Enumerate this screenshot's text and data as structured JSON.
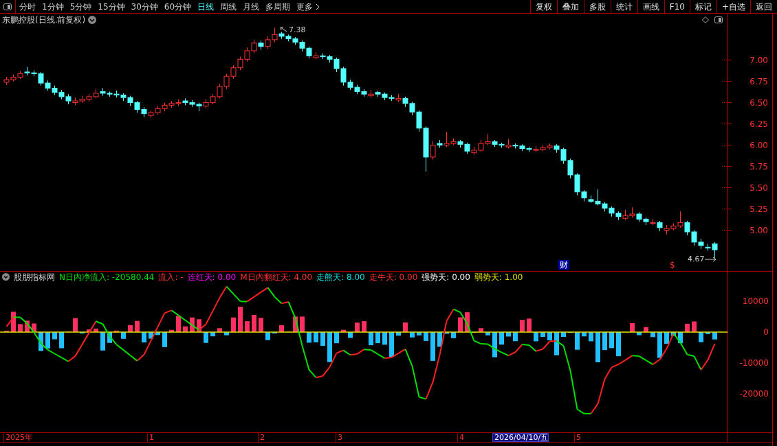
{
  "toolbar": {
    "periods": [
      {
        "label": "分时",
        "selected": false
      },
      {
        "label": "1分钟",
        "selected": false
      },
      {
        "label": "5分钟",
        "selected": false
      },
      {
        "label": "15分钟",
        "selected": false
      },
      {
        "label": "30分钟",
        "selected": false
      },
      {
        "label": "60分钟",
        "selected": false
      },
      {
        "label": "日线",
        "selected": true
      },
      {
        "label": "周线",
        "selected": false
      },
      {
        "label": "月线",
        "selected": false
      },
      {
        "label": "多周期",
        "selected": false
      }
    ],
    "more": "更多",
    "actions": [
      "复权",
      "叠加",
      "多股",
      "统计",
      "画线",
      "F10",
      "标记",
      "+自选",
      "返回"
    ]
  },
  "price_panel": {
    "title": "东鹏控股(日线.前复权)",
    "high_label": "7.38",
    "low_label": "4.67",
    "markers": [
      {
        "text": "财",
        "kind": "finance"
      },
      {
        "text": "$",
        "kind": "dividend"
      }
    ],
    "chart_data": {
      "type": "candlestick",
      "ylim": [
        4.52,
        7.4
      ],
      "yticks": [
        {
          "value": 7,
          "label": "7.00"
        },
        {
          "value": 6.75,
          "label": "6.75"
        },
        {
          "value": 6.5,
          "label": "6.50"
        },
        {
          "value": 6.25,
          "label": "6.25"
        },
        {
          "value": 6,
          "label": "6.00"
        },
        {
          "value": 5.75,
          "label": "5.75"
        },
        {
          "value": 5.5,
          "label": "5.50"
        },
        {
          "value": 5.25,
          "label": "5.25"
        },
        {
          "value": 5,
          "label": "5.00"
        }
      ],
      "ohlc": [
        [
          6.74,
          6.8,
          6.71,
          6.77
        ],
        [
          6.77,
          6.83,
          6.75,
          6.8
        ],
        [
          6.8,
          6.87,
          6.78,
          6.84
        ],
        [
          6.86,
          6.92,
          6.82,
          6.85
        ],
        [
          6.85,
          6.88,
          6.81,
          6.84
        ],
        [
          6.84,
          6.86,
          6.7,
          6.73
        ],
        [
          6.73,
          6.76,
          6.64,
          6.67
        ],
        [
          6.67,
          6.7,
          6.59,
          6.62
        ],
        [
          6.62,
          6.65,
          6.54,
          6.57
        ],
        [
          6.57,
          6.6,
          6.48,
          6.52
        ],
        [
          6.5,
          6.56,
          6.47,
          6.52
        ],
        [
          6.52,
          6.58,
          6.5,
          6.54
        ],
        [
          6.54,
          6.6,
          6.51,
          6.57
        ],
        [
          6.57,
          6.66,
          6.55,
          6.61
        ],
        [
          6.63,
          6.67,
          6.58,
          6.61
        ],
        [
          6.61,
          6.63,
          6.57,
          6.6
        ],
        [
          6.6,
          6.64,
          6.56,
          6.59
        ],
        [
          6.59,
          6.61,
          6.52,
          6.56
        ],
        [
          6.56,
          6.58,
          6.46,
          6.5
        ],
        [
          6.5,
          6.52,
          6.38,
          6.42
        ],
        [
          6.42,
          6.45,
          6.33,
          6.37
        ],
        [
          6.35,
          6.41,
          6.32,
          6.38
        ],
        [
          6.38,
          6.46,
          6.36,
          6.43
        ],
        [
          6.43,
          6.5,
          6.4,
          6.47
        ],
        [
          6.47,
          6.52,
          6.44,
          6.49
        ],
        [
          6.49,
          6.54,
          6.46,
          6.5
        ],
        [
          6.52,
          6.55,
          6.47,
          6.5
        ],
        [
          6.5,
          6.53,
          6.45,
          6.48
        ],
        [
          6.48,
          6.5,
          6.4,
          6.46
        ],
        [
          6.46,
          6.54,
          6.44,
          6.5
        ],
        [
          6.5,
          6.6,
          6.48,
          6.57
        ],
        [
          6.57,
          6.72,
          6.55,
          6.69
        ],
        [
          6.69,
          6.84,
          6.66,
          6.81
        ],
        [
          6.81,
          6.94,
          6.78,
          6.91
        ],
        [
          6.91,
          7.04,
          6.88,
          7.01
        ],
        [
          7.01,
          7.15,
          6.98,
          7.11
        ],
        [
          7.11,
          7.24,
          7.08,
          7.2
        ],
        [
          7.2,
          7.23,
          7.12,
          7.16
        ],
        [
          7.16,
          7.28,
          7.13,
          7.24
        ],
        [
          7.24,
          7.38,
          7.21,
          7.3
        ],
        [
          7.31,
          7.33,
          7.25,
          7.28
        ],
        [
          7.28,
          7.3,
          7.22,
          7.25
        ],
        [
          7.25,
          7.27,
          7.18,
          7.21
        ],
        [
          7.21,
          7.23,
          7.1,
          7.14
        ],
        [
          7.14,
          7.16,
          7.02,
          7.05
        ],
        [
          7.03,
          7.09,
          7.01,
          7.05
        ],
        [
          7.05,
          7.08,
          7.01,
          7.04
        ],
        [
          7.04,
          7.06,
          6.97,
          7.01
        ],
        [
          7.01,
          7.03,
          6.86,
          6.9
        ],
        [
          6.9,
          6.92,
          6.7,
          6.74
        ],
        [
          6.74,
          6.77,
          6.65,
          6.68
        ],
        [
          6.68,
          6.71,
          6.6,
          6.63
        ],
        [
          6.63,
          6.66,
          6.57,
          6.6
        ],
        [
          6.58,
          6.65,
          6.56,
          6.6
        ],
        [
          6.62,
          6.64,
          6.57,
          6.6
        ],
        [
          6.6,
          6.62,
          6.53,
          6.56
        ],
        [
          6.56,
          6.59,
          6.52,
          6.55
        ],
        [
          6.53,
          6.6,
          6.51,
          6.55
        ],
        [
          6.55,
          6.57,
          6.45,
          6.49
        ],
        [
          6.49,
          6.51,
          6.35,
          6.39
        ],
        [
          6.39,
          6.41,
          6.16,
          6.2
        ],
        [
          6.2,
          6.22,
          5.69,
          5.86
        ],
        [
          5.86,
          6.05,
          5.83,
          6.0
        ],
        [
          6.02,
          6.06,
          5.97,
          6.0
        ],
        [
          6.0,
          6.16,
          5.98,
          6.02
        ],
        [
          6.02,
          6.08,
          6.0,
          6.04
        ],
        [
          6.04,
          6.06,
          5.97,
          6.01
        ],
        [
          6.01,
          6.03,
          5.9,
          5.93
        ],
        [
          5.91,
          5.98,
          5.89,
          5.94
        ],
        [
          5.94,
          6.06,
          5.92,
          6.02
        ],
        [
          6.02,
          6.13,
          6.0,
          6.04
        ],
        [
          6.04,
          6.06,
          5.98,
          6.01
        ],
        [
          6.01,
          6.03,
          5.97,
          6.0
        ],
        [
          5.98,
          6.07,
          5.96,
          6.0
        ],
        [
          6.0,
          6.02,
          5.96,
          5.99
        ],
        [
          5.99,
          6.01,
          5.93,
          5.96
        ],
        [
          5.96,
          5.98,
          5.92,
          5.95
        ],
        [
          5.94,
          5.99,
          5.92,
          5.95
        ],
        [
          5.95,
          6.0,
          5.93,
          5.97
        ],
        [
          5.97,
          6.02,
          5.95,
          5.99
        ],
        [
          5.99,
          6.01,
          5.91,
          5.95
        ],
        [
          5.95,
          5.97,
          5.78,
          5.82
        ],
        [
          5.82,
          5.84,
          5.61,
          5.65
        ],
        [
          5.65,
          5.67,
          5.41,
          5.45
        ],
        [
          5.45,
          5.47,
          5.34,
          5.38
        ],
        [
          5.36,
          5.41,
          5.32,
          5.34
        ],
        [
          5.34,
          5.48,
          5.29,
          5.31
        ],
        [
          5.31,
          5.33,
          5.22,
          5.26
        ],
        [
          5.26,
          5.28,
          5.16,
          5.2
        ],
        [
          5.2,
          5.22,
          5.12,
          5.16
        ],
        [
          5.14,
          5.24,
          5.12,
          5.17
        ],
        [
          5.17,
          5.27,
          5.15,
          5.19
        ],
        [
          5.19,
          5.21,
          5.1,
          5.13
        ],
        [
          5.13,
          5.15,
          5.06,
          5.1
        ],
        [
          5.08,
          5.13,
          5.06,
          5.09
        ],
        [
          5.09,
          5.11,
          4.99,
          5.03
        ],
        [
          5.0,
          5.06,
          4.95,
          5.02
        ],
        [
          5.02,
          5.08,
          5.0,
          5.05
        ],
        [
          5.05,
          5.22,
          5.03,
          5.09
        ],
        [
          5.09,
          5.11,
          4.94,
          4.98
        ],
        [
          4.98,
          5.0,
          4.82,
          4.86
        ],
        [
          4.86,
          4.9,
          4.78,
          4.82
        ],
        [
          4.8,
          4.84,
          4.76,
          4.79
        ],
        [
          4.84,
          4.86,
          4.67,
          4.77
        ]
      ]
    }
  },
  "indicator": {
    "name": "股朋指标网",
    "fields": [
      {
        "text": "N日内净流入: -20580.44",
        "color": "#00e000"
      },
      {
        "text": "流入: -",
        "color": "#ff3232"
      },
      {
        "text": "连红天: 0.00",
        "color": "#ff00ff"
      },
      {
        "text": "M日内翻红天: 4.00",
        "color": "#ff3232"
      },
      {
        "text": "走熊天: 8.00",
        "color": "#00e0e0"
      },
      {
        "text": "走牛天: 0.00",
        "color": "#ff3232"
      },
      {
        "text": "强势天: 0.00",
        "color": "#ffffff"
      },
      {
        "text": "弱势天: 1.00",
        "color": "#e0e000"
      }
    ],
    "yticks": [
      "10000",
      "0",
      "-10000",
      "-20000"
    ]
  },
  "time_axis": {
    "labels": [
      {
        "text": "2025年",
        "selected": false
      },
      {
        "text": "1",
        "selected": false
      },
      {
        "text": "2",
        "selected": false
      },
      {
        "text": "3",
        "selected": false
      },
      {
        "text": "4",
        "selected": false
      },
      {
        "text": "2026/04/10/五",
        "selected": true
      },
      {
        "text": "5",
        "selected": false
      }
    ]
  }
}
